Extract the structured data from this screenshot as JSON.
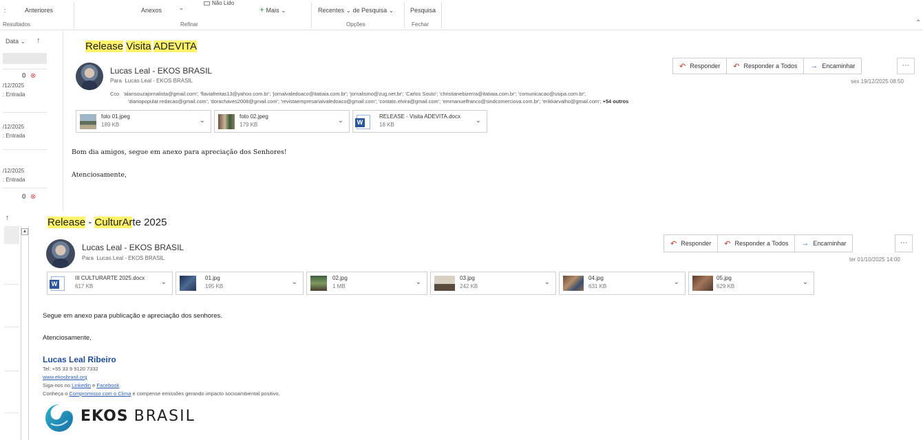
{
  "ribbon": {
    "anteriores": "Anteriores",
    "resultados": "Resultados",
    "anexos": "Anexos",
    "nao_lido": "Não Lido",
    "mais": "Mais",
    "refinar": "Refinar",
    "recentes": "Recentes",
    "de_pesquisa": "de Pesquisa",
    "opcoes": "Opções",
    "pesquisa": "Pesquisa",
    "fechar": "Fechar"
  },
  "list_pane": {
    "sort_label": "Data",
    "items": [
      {
        "date": "/12/2025",
        "folder": ": Entrada"
      },
      {
        "date": "/12/2025",
        "folder": ": Entrada"
      },
      {
        "date": "/12/2025",
        "folder": ": Entrada"
      }
    ]
  },
  "email1": {
    "subject_parts": [
      "Release",
      "Visita",
      "ADEVITA"
    ],
    "sender": "Lucas Leal -  EKOS BRASIL",
    "to_label": "Para",
    "to": "Lucas Leal - EKOS BRASIL",
    "cc_label": "Cco",
    "cc_line1": "'alansouzajornalista@gmail.com'; 'flaviafreitas13@yahoo.com.br'; 'jornalvaledoaco@itatiaia.com.br'; 'jornalismo@zug.net.br'; 'Carlos Souto'; 'christianebizerra@itatiaia.com.br'; 'comunicacao@usipa.com.br';",
    "cc_line2": "'diariopopular.redacao@gmail.com'; 'dorachaves2008@gmail.com'; 'revistaempresarialvaledoaco@gmail.com'; 'contato.elvira@gmail.com'; 'emmanuelfranco@sindcomerciova.com.br'; 'erikkarvalho@gmail.com';",
    "cc_more": "+54 outros",
    "date": "sex 19/12/2025 08:50",
    "attachments": [
      {
        "name": "foto 01.jpeg",
        "size": "189 KB"
      },
      {
        "name": "foto 02.jpeg",
        "size": "179 KB"
      },
      {
        "name": "RELEASE - Visita ADEVITA.docx",
        "size": "18 KB"
      }
    ],
    "body_line1": "Bom dia amigos, segue em anexo para apreciação dos Senhores!",
    "body_line2": "Atenciosamente,"
  },
  "email2": {
    "subject_parts": [
      "Release",
      " - ",
      "CulturAr",
      "te 2025"
    ],
    "sender": "Lucas Leal -  EKOS BRASIL",
    "to_label": "Para",
    "to": "Lucas Leal - EKOS BRASIL",
    "date": "ter 01/10/2025 14:00",
    "attachments": [
      {
        "name": "III CULTURARTE 2025.docx",
        "size": "617 KB"
      },
      {
        "name": "01.jpg",
        "size": "195 KB"
      },
      {
        "name": "02.jpg",
        "size": "1 MB"
      },
      {
        "name": "03.jpg",
        "size": "242 KB"
      },
      {
        "name": "04.jpg",
        "size": "631 KB"
      },
      {
        "name": "05.jpg",
        "size": "629 KB"
      }
    ],
    "body_line1": "Segue em anexo para publicação e apreciação dos senhores.",
    "body_line2": "Atenciosamente,",
    "signature": {
      "name": "Lucas Leal Ribeiro",
      "tel": "Tel: +55 33 9 9120 7332",
      "site": "www.ekosbrasil.org",
      "follow_prefix": "Siga-nos no ",
      "linkedin": "Linkedin",
      "follow_mid": " e ",
      "facebook": "Facebook",
      "climate_prefix": "Conheça o ",
      "climate_link": "Compromisso com o Clima",
      "climate_suffix": " e compense emissões gerando impacto socioambiental positivo.",
      "logo_bold": "EKOS",
      "logo_light": "BRASIL"
    }
  },
  "actions": {
    "reply": "Responder",
    "reply_all": "Responder a Todos",
    "forward": "Encaminhar",
    "more": "···"
  },
  "colors": {
    "highlight": "#fff26b",
    "signature_name": "#1f4e9a",
    "link": "#2b5fb8",
    "word_blue": "#2b579a"
  }
}
